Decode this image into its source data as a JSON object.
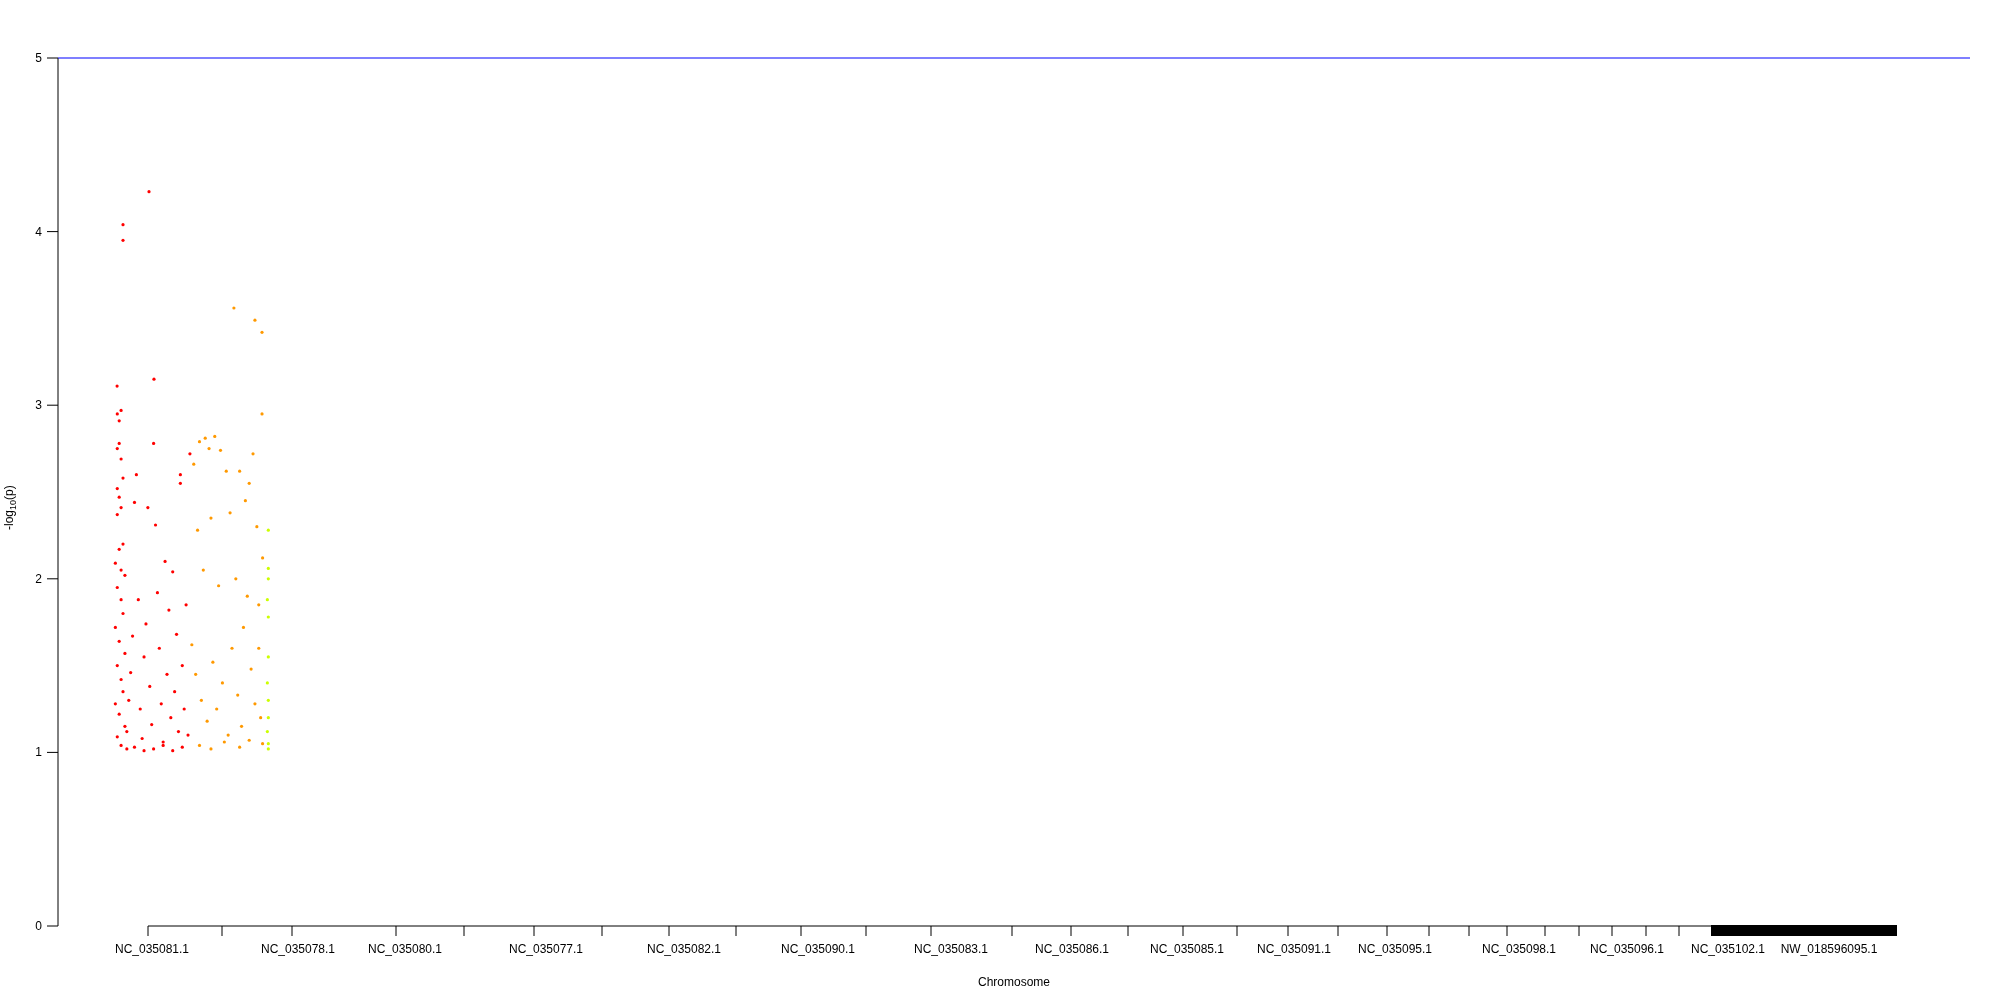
{
  "plot": {
    "y_axis": {
      "title": "-log$_{10}$(p)",
      "ticks": [
        "5",
        "4",
        "3",
        "2",
        "1",
        "0"
      ]
    },
    "x_axis": {
      "title": "Chromosome",
      "labels": [
        "NC_035081.1",
        "NC_035078.1",
        "NC_035080.1",
        "NC_035077.1",
        "NC_035082.1",
        "NC_035090.1",
        "NC_035083.1",
        "NC_035086.1",
        "NC_035085.1",
        "NC_035091.1",
        "NC_035095.1",
        "NC_035098.1",
        "NC_035096.1",
        "NC_035102.1",
        "NW_018596095.1"
      ]
    },
    "point_groups": [
      {
        "color": "#ff0000"
      },
      {
        "color": "#ff9900"
      },
      {
        "color": "#ccff00"
      }
    ]
  }
}
